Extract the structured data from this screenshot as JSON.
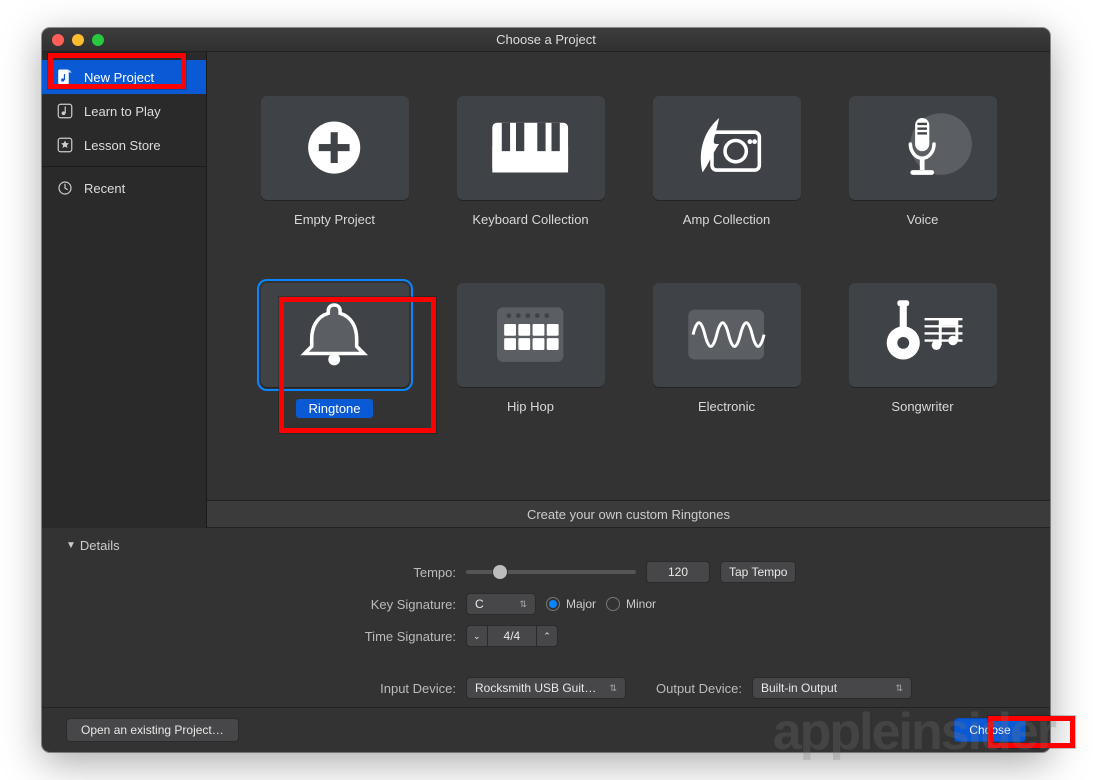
{
  "window": {
    "title": "Choose a Project"
  },
  "sidebar": {
    "items": [
      {
        "label": "New Project",
        "icon": "music-file-icon",
        "active": true
      },
      {
        "label": "Learn to Play",
        "icon": "note-box-icon",
        "active": false
      },
      {
        "label": "Lesson Store",
        "icon": "star-box-icon",
        "active": false
      },
      {
        "label": "Recent",
        "icon": "clock-icon",
        "active": false
      }
    ]
  },
  "projects": [
    {
      "label": "Empty Project",
      "icon": "plus-circle-icon",
      "selected": false
    },
    {
      "label": "Keyboard Collection",
      "icon": "piano-keys-icon",
      "selected": false
    },
    {
      "label": "Amp Collection",
      "icon": "guitar-amp-icon",
      "selected": false
    },
    {
      "label": "Voice",
      "icon": "microphone-icon",
      "selected": false
    },
    {
      "label": "Ringtone",
      "icon": "bell-icon",
      "selected": true
    },
    {
      "label": "Hip Hop",
      "icon": "drum-pad-icon",
      "selected": false
    },
    {
      "label": "Electronic",
      "icon": "waveform-icon",
      "selected": false
    },
    {
      "label": "Songwriter",
      "icon": "acoustic-notes-icon",
      "selected": false
    }
  ],
  "description": "Create your own custom Ringtones",
  "details": {
    "heading": "Details",
    "tempo": {
      "label": "Tempo:",
      "value": "120",
      "tap_label": "Tap Tempo"
    },
    "key": {
      "label": "Key Signature:",
      "value": "C",
      "mode_major": "Major",
      "mode_minor": "Minor",
      "selected_mode": "major"
    },
    "time": {
      "label": "Time Signature:",
      "value": "4/4"
    },
    "input": {
      "label": "Input Device:",
      "value": "Rocksmith USB Guit…"
    },
    "output": {
      "label": "Output Device:",
      "value": "Built-in Output"
    }
  },
  "footer": {
    "open_label": "Open an existing Project…",
    "choose_label": "Choose"
  },
  "watermark": "appleinsider"
}
